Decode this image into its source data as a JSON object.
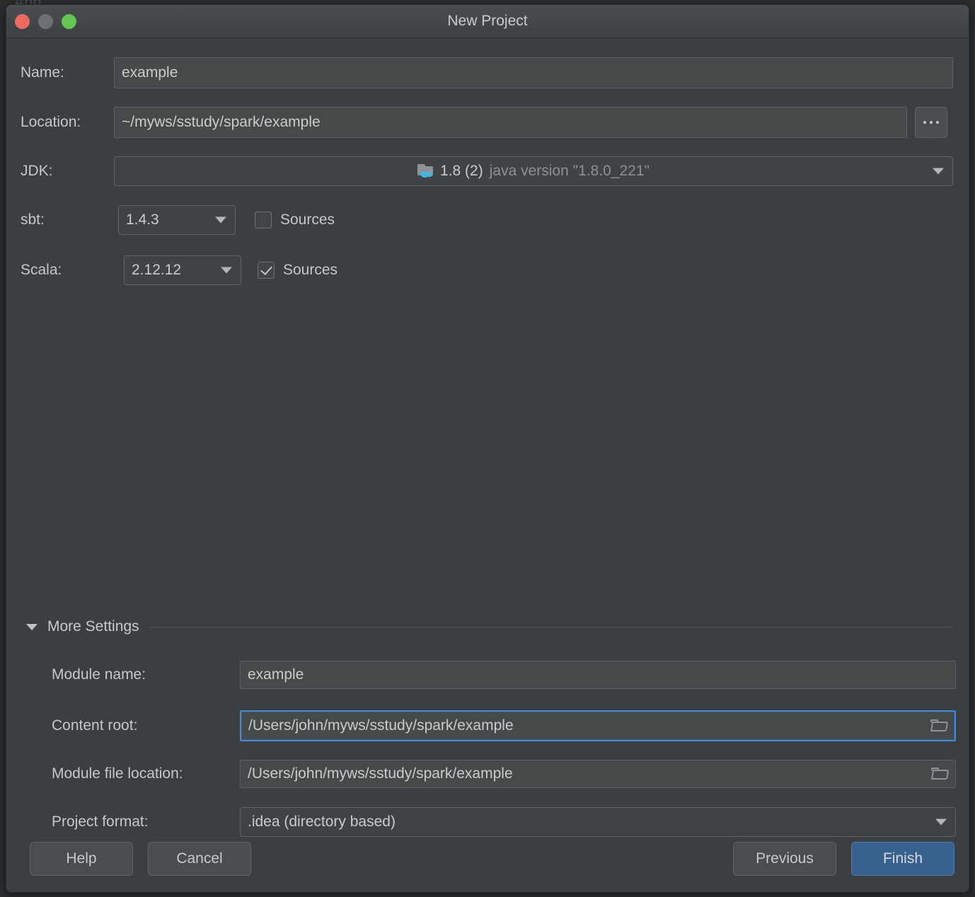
{
  "window": {
    "title": "New Project",
    "traffic_lights": [
      "close-red",
      "minimize-gray",
      "maximize-green"
    ]
  },
  "background_hint": "App",
  "form": {
    "name": {
      "label": "Name:",
      "value": "example"
    },
    "location": {
      "label": "Location:",
      "value": "~/myws/sstudy/spark/example",
      "browse_label": "..."
    },
    "jdk": {
      "label": "JDK:",
      "value": "1.8 (2)",
      "detail": "java version \"1.8.0_221\"",
      "icon": "jdk-folder-coffee-icon"
    },
    "sbt": {
      "label": "sbt:",
      "value": "1.4.3",
      "sources_label": "Sources",
      "sources_checked": false
    },
    "scala": {
      "label": "Scala:",
      "value": "2.12.12",
      "sources_label": "Sources",
      "sources_checked": true
    }
  },
  "more_settings": {
    "title": "More Settings",
    "expanded": true,
    "module_name": {
      "label": "Module name:",
      "value": "example"
    },
    "content_root": {
      "label": "Content root:",
      "value": "/Users/john/myws/sstudy/spark/example",
      "focused": true
    },
    "module_file_location": {
      "label": "Module file location:",
      "value": "/Users/john/myws/sstudy/spark/example"
    },
    "project_format": {
      "label": "Project format:",
      "value": ".idea (directory based)"
    }
  },
  "buttons": {
    "help": "Help",
    "cancel": "Cancel",
    "previous": "Previous",
    "finish": "Finish"
  },
  "colors": {
    "dialog_bg": "#3c3f41",
    "field_bg": "#45494a",
    "text": "#c5c8ca",
    "muted_text": "#8e9193",
    "focus_blue": "#4a88c7",
    "primary_button": "#38618f",
    "jdk_cup": "#40b6e0"
  }
}
